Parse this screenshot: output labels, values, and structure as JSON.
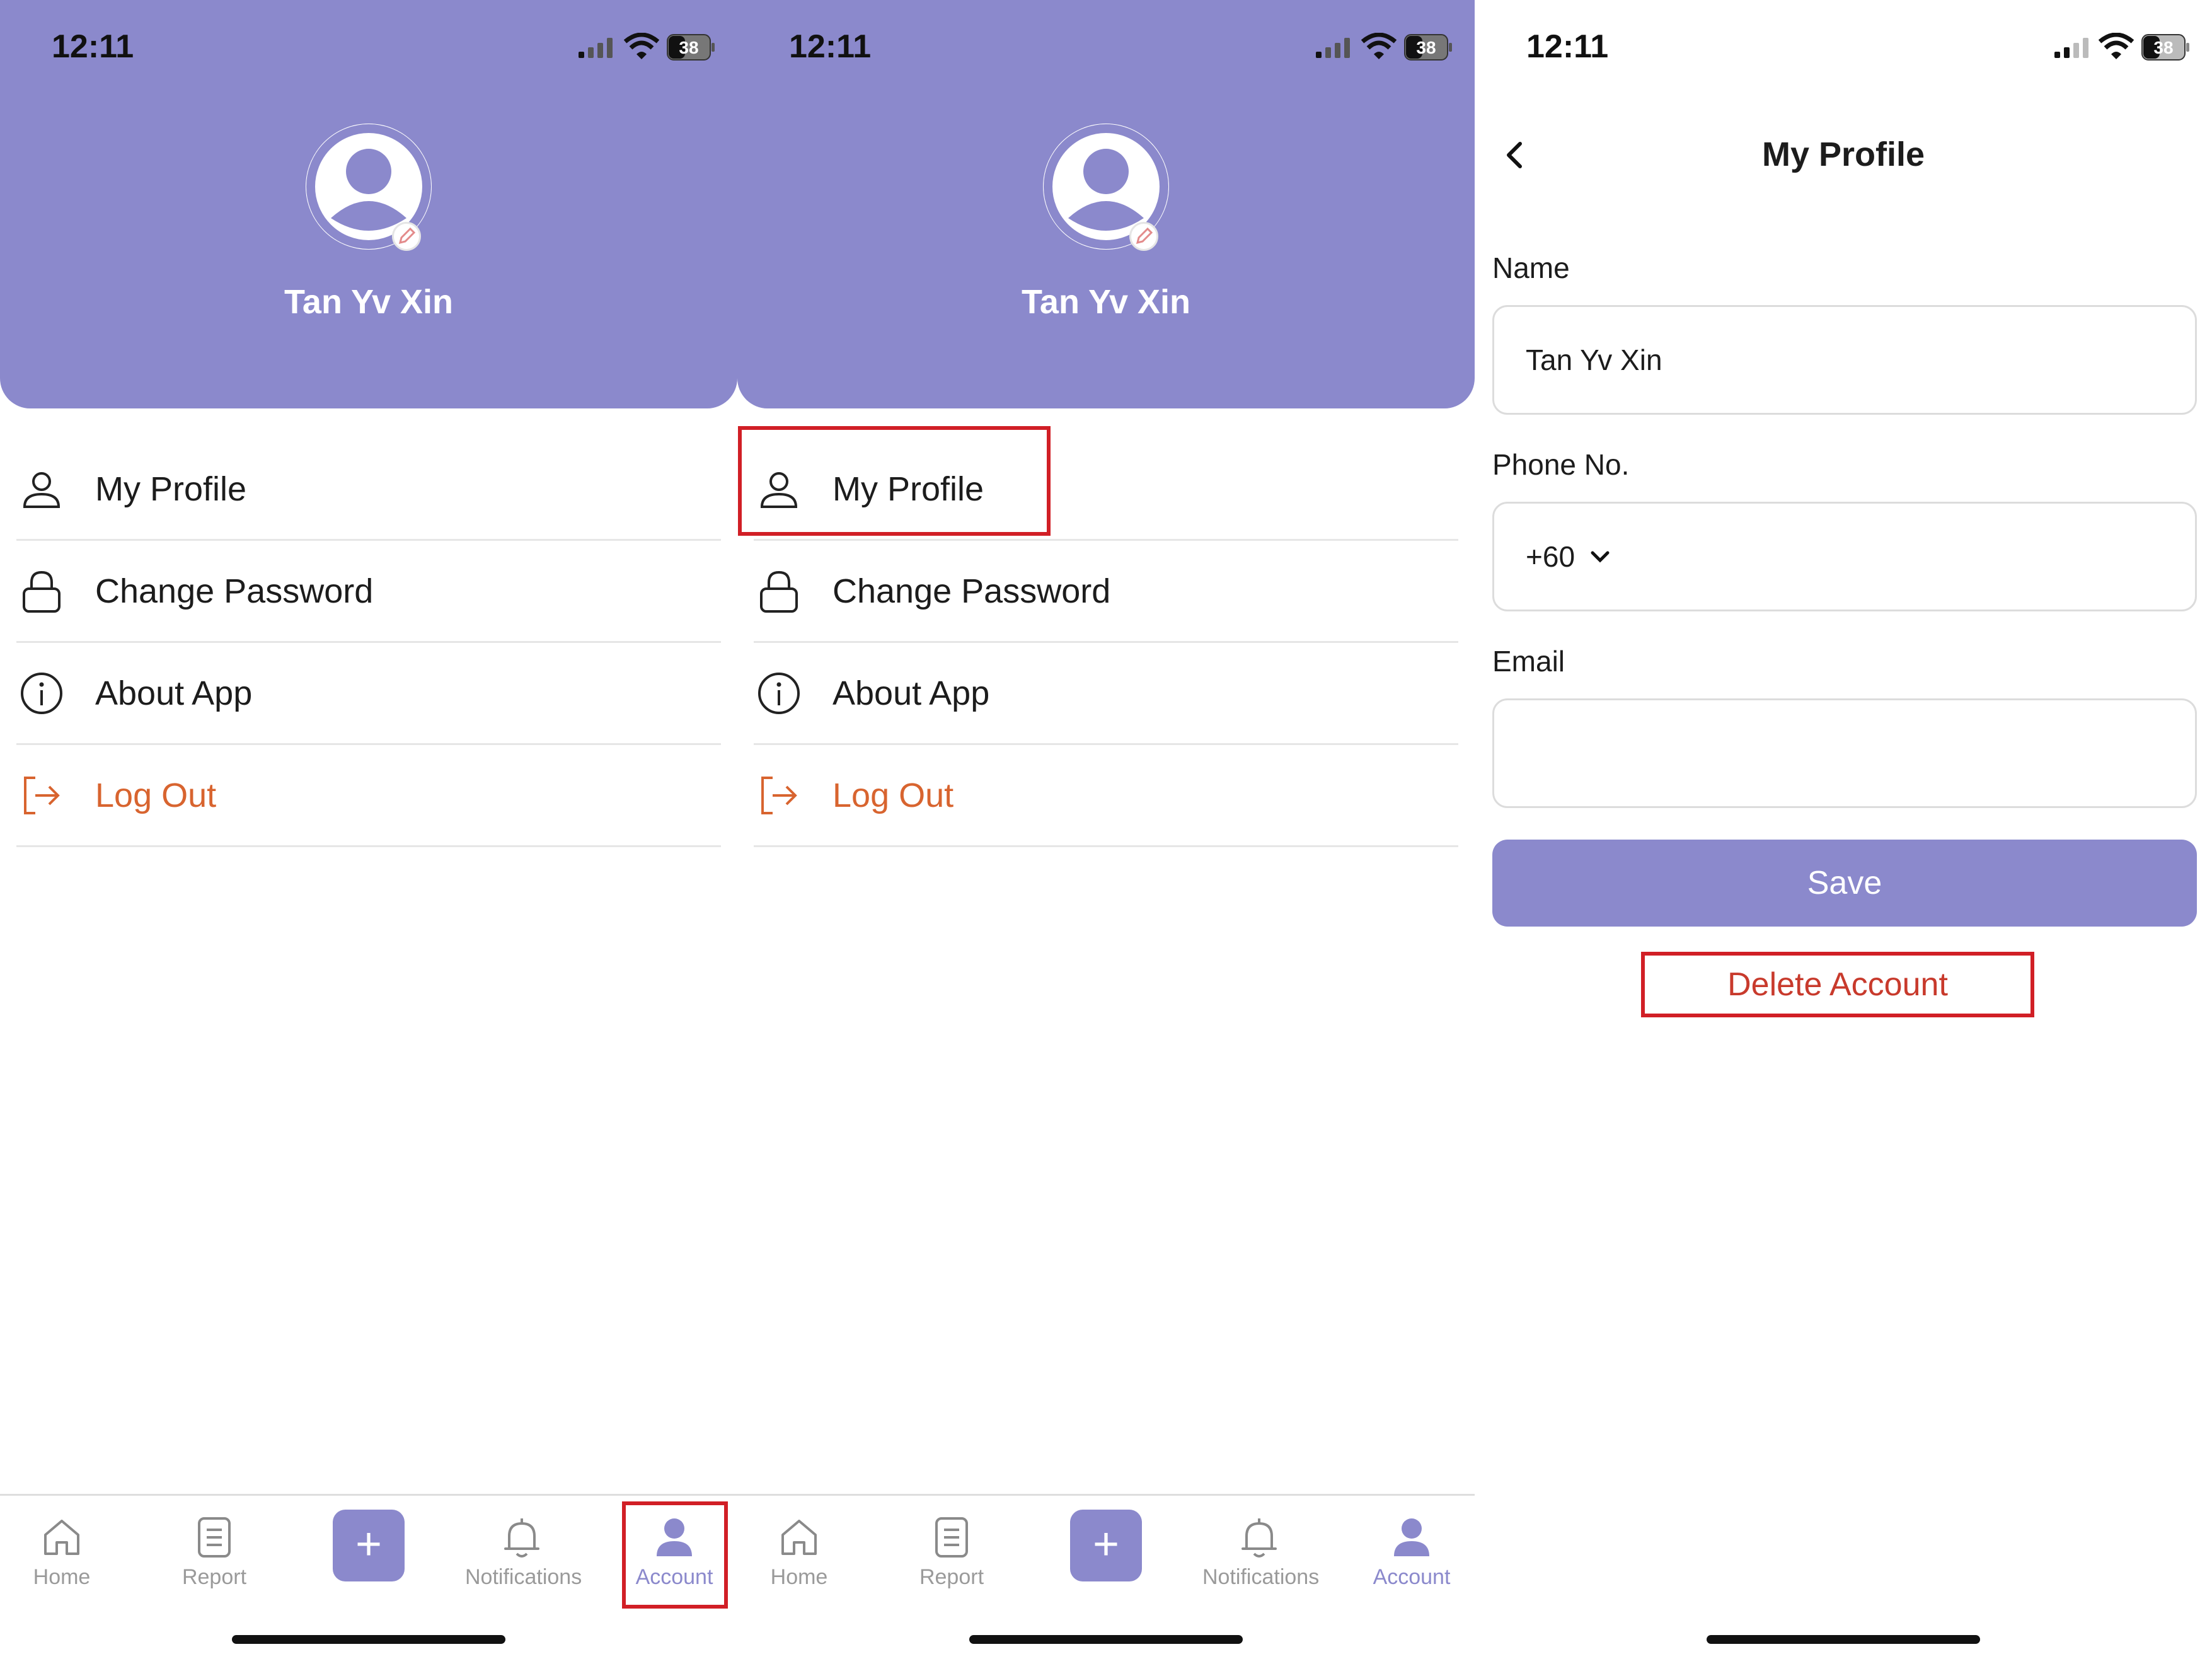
{
  "status_bar": {
    "time": "12:11",
    "battery": "38"
  },
  "account": {
    "user_name": "Tan Yv Xin",
    "menu": [
      {
        "label": "My Profile",
        "icon": "user-icon"
      },
      {
        "label": "Change Password",
        "icon": "lock-icon"
      },
      {
        "label": "About App",
        "icon": "info-icon"
      },
      {
        "label": "Log Out",
        "icon": "logout-icon"
      }
    ]
  },
  "tabbar": {
    "tabs": [
      {
        "label": "Home",
        "icon": "home-icon"
      },
      {
        "label": "Report",
        "icon": "report-icon"
      },
      {
        "label": "+",
        "icon": "plus-icon"
      },
      {
        "label": "Notifications",
        "icon": "bell-icon"
      },
      {
        "label": "Account",
        "icon": "account-icon"
      }
    ],
    "active": "Account"
  },
  "profile": {
    "title": "My Profile",
    "name_label": "Name",
    "name_value": "Tan Yv Xin",
    "phone_label": "Phone No.",
    "phone_code": "+60",
    "email_label": "Email",
    "email_value": "",
    "save_label": "Save",
    "delete_label": "Delete Account"
  },
  "colors": {
    "accent": "#8b89cc",
    "logout": "#d8642f",
    "delete": "#c83a2c",
    "highlight": "#d11f26"
  }
}
